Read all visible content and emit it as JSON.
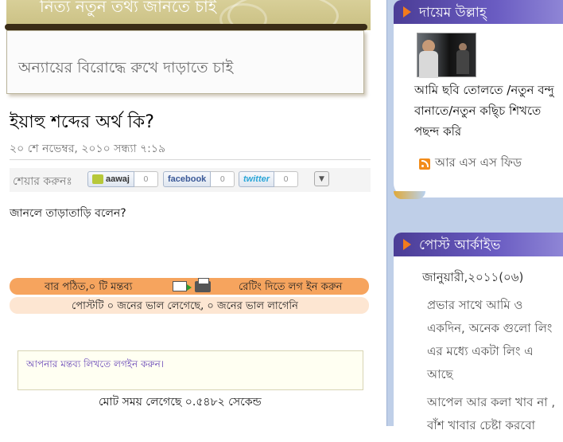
{
  "banner": {
    "title": "নিত্য নতুন তথ্য জানতে চাই",
    "slogan": "অন্যায়ের বিরোদ্ধে রুখে দাড়াতে চাই"
  },
  "post": {
    "title": "ইয়াহু শব্দের অর্থ কি?",
    "date": "২০ শে নভেম্বর, ২০১০ সন্ধ্যা ৭:১৯",
    "body": "জানলে তাড়াতাড়ি বলেন?"
  },
  "share": {
    "label": "শেয়ার করুনঃ",
    "buttons": [
      {
        "name": "aawaj",
        "count": "0"
      },
      {
        "name": "facebook",
        "count": "0"
      },
      {
        "name": "twitter",
        "count": "0"
      }
    ]
  },
  "meta": {
    "views": "বার পঠিত,০ টি মন্তব্য",
    "rating": "রেটিং দিতে লগ ইন করুন",
    "likes": "পোস্টটি ০ জনের ভাল লেগেছে, ০ জনের ভাল লাগেনি"
  },
  "comment": {
    "login_prompt": "আপনার মন্তব্য লিখতে লগইন করুন।"
  },
  "footer": {
    "time": "মোট সময় লেগেছে ০.৫৪৮২ সেকেন্ড"
  },
  "sidebar": {
    "profile": {
      "name": "দায়েম উল্লাহ্",
      "bio": "আমি ছবি তোলতে /নতুন বন্দু বানাতে/নতুন কছ্চি শিখতে পছন্দ করি",
      "rss": "আর এস এস ফিড"
    },
    "archive": {
      "title": "পোস্ট আর্কাইভ",
      "month": "জানুয়ারী,২০১১(০৬)",
      "items": [
        "প্রভার সাথে আমি ও একদিন, অনেক গুলো লিং এর মধ্যে একটা লিং এ আছে",
        "আপেল আর কলা খাব না , বাঁশ খাবার চেষ্টা করবো"
      ]
    }
  },
  "colors": {
    "meta_bar": "#f6a45e",
    "like_bar": "#fde6d2",
    "sidebar_bg": "#bfcfe8",
    "sidebar_header": "#4b3d96",
    "header_arrow": "#f27b1d"
  }
}
